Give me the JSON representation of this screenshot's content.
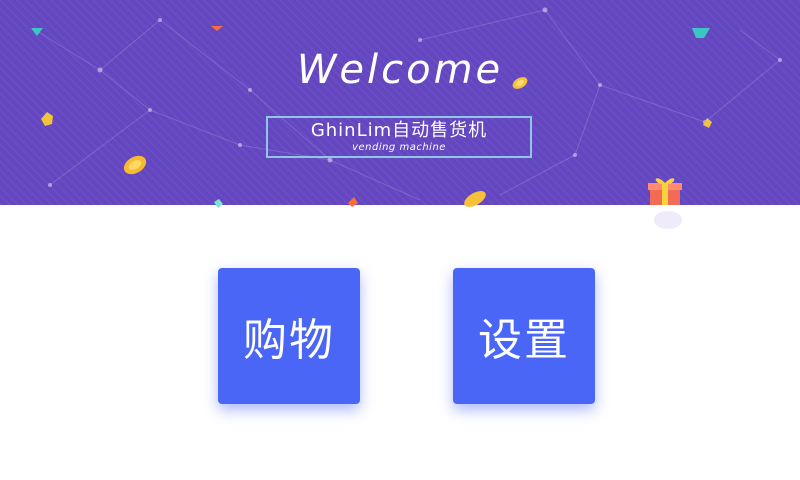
{
  "banner": {
    "welcome_text": "Welcome",
    "brand_title": "GhinLim自动售货机",
    "brand_subtitle": "vending machine",
    "background_color": "#6447c0",
    "decorations": [
      "coin-icon",
      "gem-icon",
      "gift-icon",
      "network-lines"
    ]
  },
  "menu": {
    "shop_label": "购物",
    "settings_label": "设置",
    "button_color": "#4a66f6"
  }
}
